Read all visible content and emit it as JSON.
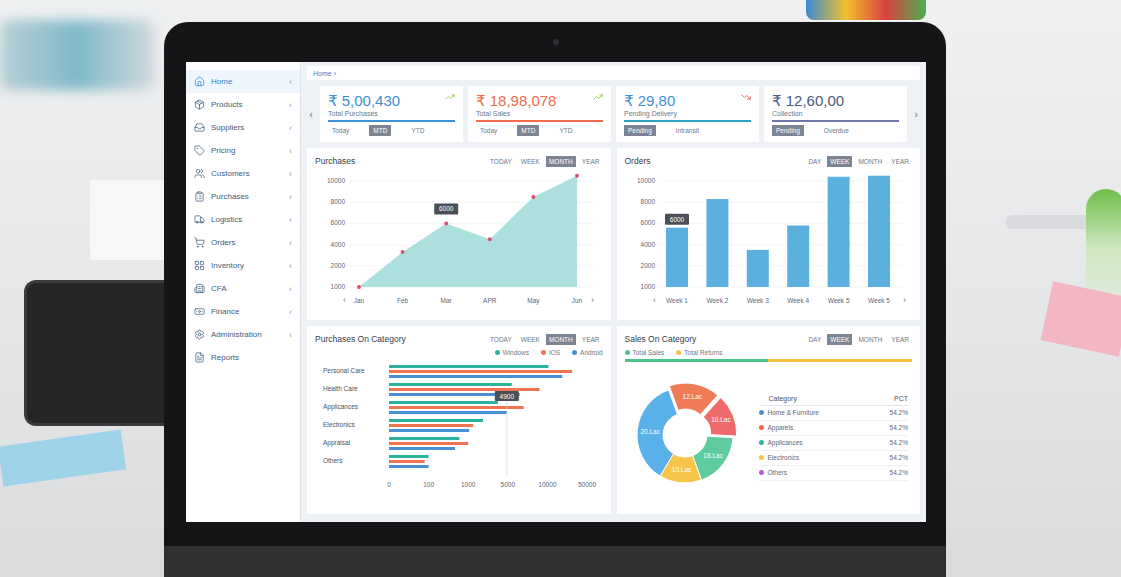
{
  "sidebar": {
    "chevron": "‹",
    "items": [
      {
        "label": "Home",
        "selected": true,
        "expandable": true
      },
      {
        "label": "Products",
        "selected": false,
        "expandable": true
      },
      {
        "label": "Suppliers",
        "selected": false,
        "expandable": true
      },
      {
        "label": "Pricing",
        "selected": false,
        "expandable": true
      },
      {
        "label": "Customers",
        "selected": false,
        "expandable": true
      },
      {
        "label": "Purchases",
        "selected": false,
        "expandable": true
      },
      {
        "label": "Logistics",
        "selected": false,
        "expandable": true
      },
      {
        "label": "Orders",
        "selected": false,
        "expandable": true
      },
      {
        "label": "Inventory",
        "selected": false,
        "expandable": true
      },
      {
        "label": "CFA",
        "selected": false,
        "expandable": true
      },
      {
        "label": "Finance",
        "selected": false,
        "expandable": true
      },
      {
        "label": "Administration",
        "selected": false,
        "expandable": true
      },
      {
        "label": "Reports",
        "selected": false,
        "expandable": false
      }
    ]
  },
  "breadcrumb": {
    "label": "Home",
    "separator": "›"
  },
  "carousel": {
    "prev": "‹",
    "next": "›"
  },
  "stats": [
    {
      "value": "₹ 5,00,430",
      "label": "Total Purchases",
      "trend": "up",
      "color": "#3d8fd8",
      "accent": "#3d8fd8",
      "tabs": [
        {
          "label": "Today",
          "selected": false
        },
        {
          "label": "MTD",
          "selected": true
        },
        {
          "label": "YTD",
          "selected": false
        }
      ]
    },
    {
      "value": "₹ 18,98,078",
      "label": "Total Sales",
      "trend": "up",
      "color": "#f26a4b",
      "accent": "#f26a4b",
      "tabs": [
        {
          "label": "Today",
          "selected": false
        },
        {
          "label": "MTD",
          "selected": true
        },
        {
          "label": "YTD",
          "selected": false
        }
      ]
    },
    {
      "value": "₹ 29,80",
      "label": "Pending Delivery",
      "trend": "down",
      "color": "#3d8fd8",
      "accent": "#2ba3c2",
      "tabs": [
        {
          "label": "Pending",
          "selected": true
        },
        {
          "label": "Intransit",
          "selected": false
        }
      ]
    },
    {
      "value": "₹ 12,60,00",
      "label": "Collection",
      "trend": "none",
      "color": "#4a5c7c",
      "accent": "#6f78a8",
      "tabs": [
        {
          "label": "Pending",
          "selected": true
        },
        {
          "label": "Overdue",
          "selected": false
        }
      ]
    }
  ],
  "purchases": {
    "title": "Purchases",
    "tabs": [
      {
        "label": "TODAY",
        "selected": false
      },
      {
        "label": "WEEK",
        "selected": false
      },
      {
        "label": "MONTH",
        "selected": true
      },
      {
        "label": "YEAR",
        "selected": false
      }
    ],
    "y_ticks": [
      "10000",
      "8000",
      "6000",
      "4000",
      "2000",
      "1000"
    ],
    "x_labels": [
      "Jan",
      "Feb",
      "Mar",
      "APR",
      "May",
      "Jun"
    ],
    "values": [
      1000,
      3300,
      6000,
      4500,
      8500,
      10500
    ],
    "tooltip": {
      "label": "6000",
      "at": "Mar"
    },
    "prev": "‹",
    "next": "›"
  },
  "orders": {
    "title": "Orders",
    "tabs": [
      {
        "label": "DAY",
        "selected": false
      },
      {
        "label": "WEEK",
        "selected": true
      },
      {
        "label": "MONTH",
        "selected": false
      },
      {
        "label": "YEAR",
        "selected": false
      }
    ],
    "y_ticks": [
      "10000",
      "8000",
      "6000",
      "4000",
      "2000",
      "1000"
    ],
    "x_labels": [
      "Week 1",
      "Week 2",
      "Week 3",
      "Week 4",
      "Week 5",
      "Week 5"
    ],
    "values": [
      5600,
      8300,
      3500,
      5800,
      10400,
      10500
    ],
    "tooltip": {
      "label": "6000",
      "at": "Week 1"
    },
    "prev": "‹",
    "next": "›"
  },
  "purchases_on_category": {
    "title": "Purchases On Category",
    "tabs": [
      {
        "label": "TODAY",
        "selected": false
      },
      {
        "label": "WEEK",
        "selected": false
      },
      {
        "label": "MONTH",
        "selected": true
      },
      {
        "label": "YEAR",
        "selected": false
      }
    ],
    "categories": [
      "Personal Care",
      "Health Care",
      "Applicances",
      "Electronics",
      "Appraisal",
      "Others"
    ],
    "x_ticks": [
      "0",
      "100",
      "1000",
      "5000",
      "10000",
      "50000"
    ],
    "series": [
      {
        "name": "Windows",
        "color": "#2bb3a0",
        "values": [
          11000,
          5500,
          4000,
          2500,
          800,
          100
        ]
      },
      {
        "name": "IOS",
        "color": "#f0744f",
        "values": [
          35000,
          9000,
          7000,
          1500,
          1000,
          90
        ]
      },
      {
        "name": "Android",
        "color": "#4a90d9",
        "values": [
          25000,
          6500,
          4900,
          1100,
          700,
          100
        ]
      }
    ],
    "tooltip": {
      "label": "4900",
      "at": "Applicances",
      "series": "Android"
    }
  },
  "sales_on_category": {
    "title": "Sales On Category",
    "tabs": [
      {
        "label": "DAY",
        "selected": false
      },
      {
        "label": "WEEK",
        "selected": true
      },
      {
        "label": "MONTH",
        "selected": false
      },
      {
        "label": "YEAR",
        "selected": false
      }
    ],
    "legend": [
      {
        "label": "Total Sales",
        "color": "#4cc38a"
      },
      {
        "label": "Total Returns",
        "color": "#f5c342"
      }
    ],
    "level": 0.5,
    "segments": [
      {
        "label": "12.Lac",
        "value": 12,
        "color": "#f07c57",
        "exploded": true
      },
      {
        "label": "10.Lac",
        "value": 10,
        "color": "#ef6a6a",
        "exploded": true
      },
      {
        "label": "18.Lac",
        "value": 13,
        "color": "#5fcca0",
        "exploded": false
      },
      {
        "label": "10.Lac",
        "value": 10,
        "color": "#f6c54a",
        "exploded": false
      },
      {
        "label": "20.Lac",
        "value": 25,
        "color": "#5ab0e8",
        "exploded": false
      }
    ],
    "table": {
      "columns": [
        "Category",
        "PCT"
      ],
      "rows": [
        {
          "category": "Home & Furniture",
          "pct": "54.2%",
          "color": "#4a90d9"
        },
        {
          "category": "Apparels",
          "pct": "54.2%",
          "color": "#f0643c"
        },
        {
          "category": "Applicances",
          "pct": "54.2%",
          "color": "#2bb3a0"
        },
        {
          "category": "Electronics",
          "pct": "54.2%",
          "color": "#f5c342"
        },
        {
          "category": "Others",
          "pct": "54.2%",
          "color": "#b35ad9"
        }
      ]
    }
  }
}
